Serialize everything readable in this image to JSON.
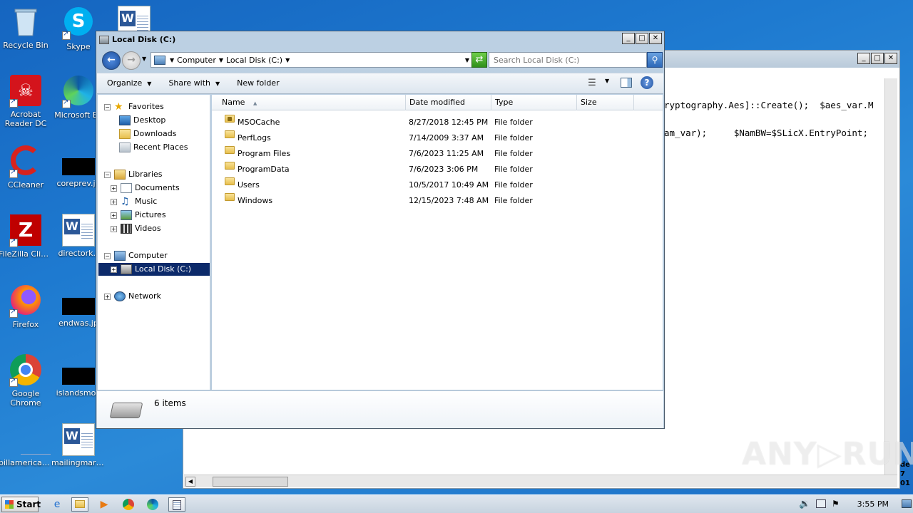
{
  "desktop": {
    "icons": {
      "recycle_bin": "Recycle Bin",
      "skype": "Skype",
      "acrobat": "Acrobat\nReader DC",
      "edge": "Microsoft Ed",
      "ccleaner": "CCleaner",
      "coreprev": "coreprev.jp",
      "filezilla": "FileZilla Client",
      "directork": "directork.r",
      "firefox": "Firefox",
      "endwas": "endwas.jp",
      "chrome": "Google\nChrome",
      "islandsmod": "islandsmod",
      "billamerican": "billamerican....",
      "mailingmark": "mailingmark.rtf"
    }
  },
  "background_window": {
    "code_line1": "ryptography.Aes]::Create();  $aes_var.M",
    "code_line2": "am_var);     $NamBW=$SLicX.EntryPoint;",
    "side_text": "de\n7\n01"
  },
  "watermark": "ANY▷RUN",
  "explorer": {
    "title": "Local Disk (C:)",
    "address": {
      "segments": [
        "Computer",
        "Local Disk (C:)"
      ],
      "sep": "▸"
    },
    "search_placeholder": "Search Local Disk (C:)",
    "toolbar": {
      "organize": "Organize",
      "share_with": "Share with",
      "new_folder": "New folder"
    },
    "nav": {
      "favorites": "Favorites",
      "desktop": "Desktop",
      "downloads": "Downloads",
      "recent_places": "Recent Places",
      "libraries": "Libraries",
      "documents": "Documents",
      "music": "Music",
      "pictures": "Pictures",
      "videos": "Videos",
      "computer": "Computer",
      "local_disk": "Local Disk (C:)",
      "network": "Network"
    },
    "columns": {
      "name": "Name",
      "date_modified": "Date modified",
      "type": "Type",
      "size": "Size"
    },
    "files": [
      {
        "name": "MSOCache",
        "date": "8/27/2018 12:45 PM",
        "type": "File folder",
        "locked": true
      },
      {
        "name": "PerfLogs",
        "date": "7/14/2009 3:37 AM",
        "type": "File folder"
      },
      {
        "name": "Program Files",
        "date": "7/6/2023 11:25 AM",
        "type": "File folder"
      },
      {
        "name": "ProgramData",
        "date": "7/6/2023 3:06 PM",
        "type": "File folder"
      },
      {
        "name": "Users",
        "date": "10/5/2017 10:49 AM",
        "type": "File folder"
      },
      {
        "name": "Windows",
        "date": "12/15/2023 7:48 AM",
        "type": "File folder"
      }
    ],
    "status": "6 items"
  },
  "taskbar": {
    "start": "Start",
    "clock": "3:55 PM"
  },
  "colors": {
    "desktop_bg": "#1e7ad0",
    "selection": "#0c2a6a",
    "window_frame": "#bcd0e3"
  }
}
